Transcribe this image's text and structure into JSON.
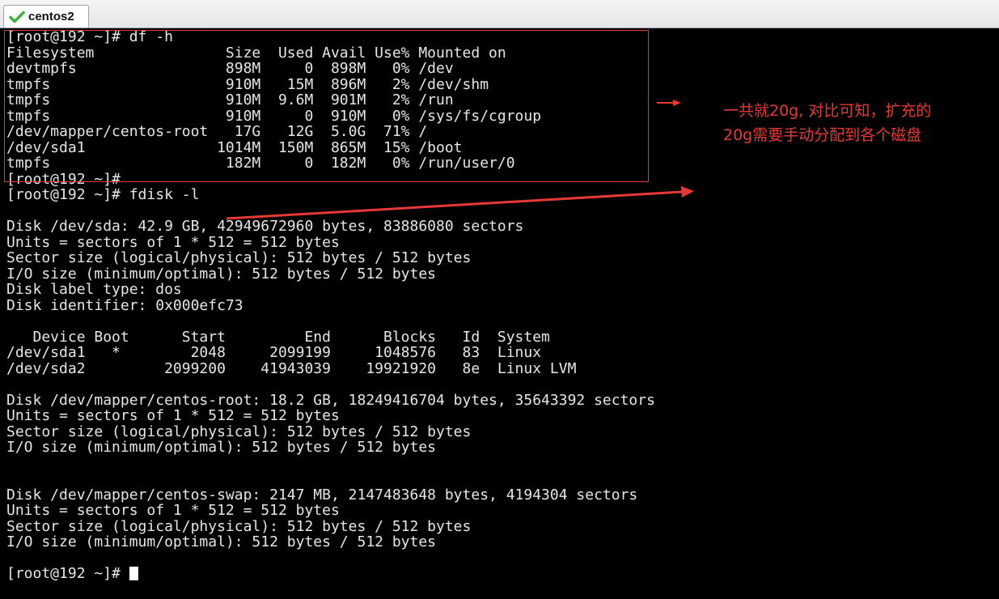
{
  "tab": {
    "title": "centos2",
    "icon": "check-icon",
    "icon_color": "#3cb043"
  },
  "colors": {
    "terminal_bg": "#000000",
    "terminal_fg": "#e6e6e6",
    "annotation": "#e53935"
  },
  "terminal": {
    "lines": [
      "[root@192 ~]# df -h",
      "Filesystem               Size  Used Avail Use% Mounted on",
      "devtmpfs                 898M     0  898M   0% /dev",
      "tmpfs                    910M   15M  896M   2% /dev/shm",
      "tmpfs                    910M  9.6M  901M   2% /run",
      "tmpfs                    910M     0  910M   0% /sys/fs/cgroup",
      "/dev/mapper/centos-root   17G   12G  5.0G  71% /",
      "/dev/sda1               1014M  150M  865M  15% /boot",
      "tmpfs                    182M     0  182M   0% /run/user/0",
      "[root@192 ~]#",
      "[root@192 ~]# fdisk -l",
      "",
      "Disk /dev/sda: 42.9 GB, 42949672960 bytes, 83886080 sectors",
      "Units = sectors of 1 * 512 = 512 bytes",
      "Sector size (logical/physical): 512 bytes / 512 bytes",
      "I/O size (minimum/optimal): 512 bytes / 512 bytes",
      "Disk label type: dos",
      "Disk identifier: 0x000efc73",
      "",
      "   Device Boot      Start         End      Blocks   Id  System",
      "/dev/sda1   *        2048     2099199     1048576   83  Linux",
      "/dev/sda2         2099200    41943039    19921920   8e  Linux LVM",
      "",
      "Disk /dev/mapper/centos-root: 18.2 GB, 18249416704 bytes, 35643392 sectors",
      "Units = sectors of 1 * 512 = 512 bytes",
      "Sector size (logical/physical): 512 bytes / 512 bytes",
      "I/O size (minimum/optimal): 512 bytes / 512 bytes",
      "",
      "",
      "Disk /dev/mapper/centos-swap: 2147 MB, 2147483648 bytes, 4194304 sectors",
      "Units = sectors of 1 * 512 = 512 bytes",
      "Sector size (logical/physical): 512 bytes / 512 bytes",
      "I/O size (minimum/optimal): 512 bytes / 512 bytes",
      ""
    ],
    "prompt": "[root@192 ~]# "
  },
  "annotation": {
    "line1": "一共就20g, 对比可知，扩充的",
    "line2": "20g需要手动分配到各个磁盘"
  }
}
